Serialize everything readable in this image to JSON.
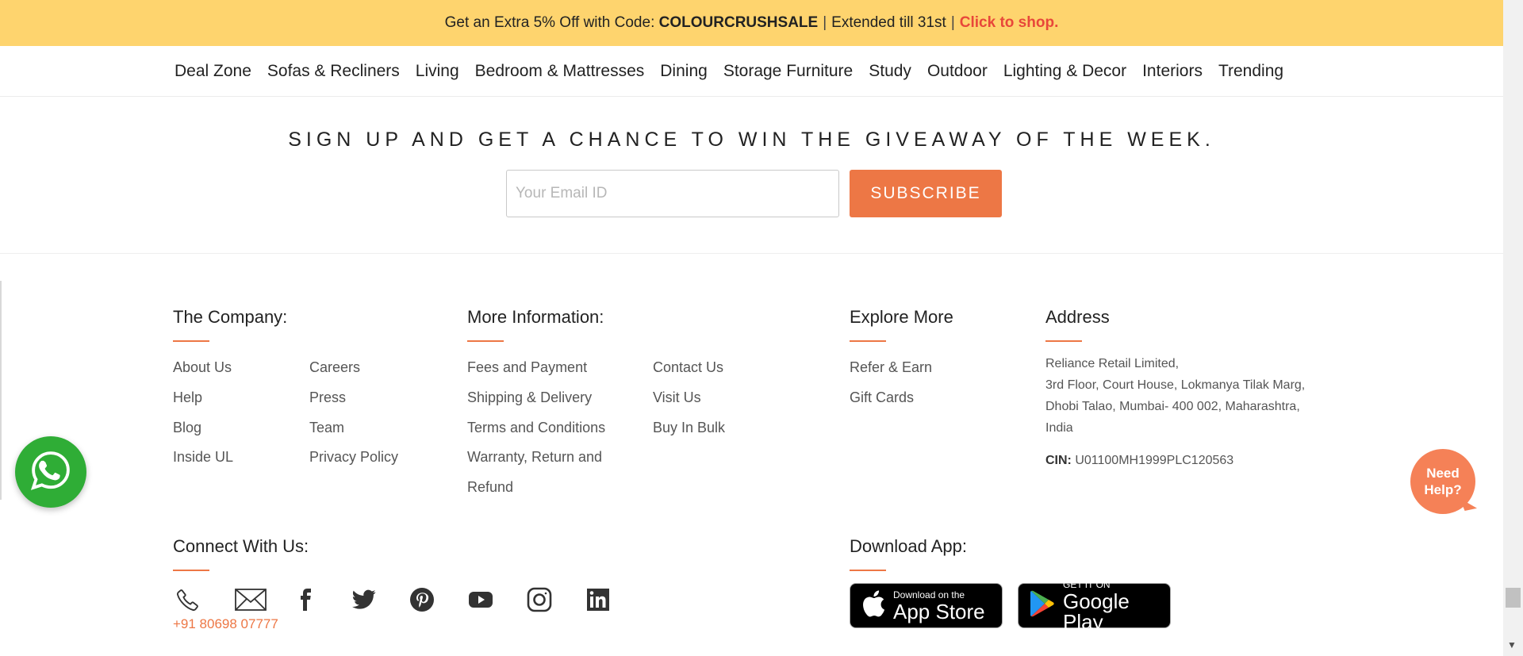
{
  "promo": {
    "prefix": "Get an Extra 5% Off with Code:",
    "code": "COLOURCRUSHSALE",
    "separator": "|",
    "extended": "Extended till 31st",
    "cta": "Click to shop."
  },
  "nav": {
    "items": [
      "Deal Zone",
      "Sofas & Recliners",
      "Living",
      "Bedroom & Mattresses",
      "Dining",
      "Storage Furniture",
      "Study",
      "Outdoor",
      "Lighting & Decor",
      "Interiors",
      "Trending"
    ]
  },
  "signup": {
    "title": "SIGN UP AND GET A CHANCE TO WIN THE GIVEAWAY OF THE WEEK.",
    "email_placeholder": "Your Email ID",
    "email_value": "",
    "subscribe_label": "SUBSCRIBE"
  },
  "footer": {
    "company": {
      "title": "The Company:",
      "links_col1": [
        "About Us",
        "Help",
        "Blog",
        "Inside UL"
      ],
      "links_col2": [
        "Careers",
        "Press",
        "Team",
        "Privacy Policy"
      ]
    },
    "more_info": {
      "title": "More Information:",
      "links_col1": [
        "Fees and Payment",
        "Shipping & Delivery",
        "Terms and Conditions",
        "Warranty, Return and",
        "Refund"
      ],
      "links_col2": [
        "Contact Us",
        "Visit Us",
        "Buy In Bulk"
      ]
    },
    "explore": {
      "title": "Explore More",
      "links": [
        "Refer & Earn",
        "Gift Cards"
      ]
    },
    "address": {
      "title": "Address",
      "lines": [
        "Reliance Retail Limited,",
        "3rd Floor, Court House, Lokmanya Tilak Marg,",
        "Dhobi Talao, Mumbai- 400 002, Maharashtra,",
        "India"
      ],
      "cin_label": "CIN:",
      "cin_value": "U01100MH1999PLC120563"
    },
    "connect": {
      "title": "Connect With Us:",
      "phone": "+91 80698 07777",
      "icons": [
        "phone-icon",
        "email-icon",
        "facebook-icon",
        "twitter-icon",
        "pinterest-icon",
        "youtube-icon",
        "instagram-icon",
        "linkedin-icon"
      ]
    },
    "download": {
      "title": "Download App:",
      "appstore_small": "Download on the",
      "appstore_big": "App Store",
      "googleplay_small": "GET IT ON",
      "googleplay_big": "Google Play"
    }
  },
  "floating": {
    "need_help": "Need Help?"
  },
  "colors": {
    "promo_bg": "#fed46e",
    "accent": "#ed7745",
    "cta_red": "#e8473a",
    "whatsapp_green": "#2fad36"
  }
}
